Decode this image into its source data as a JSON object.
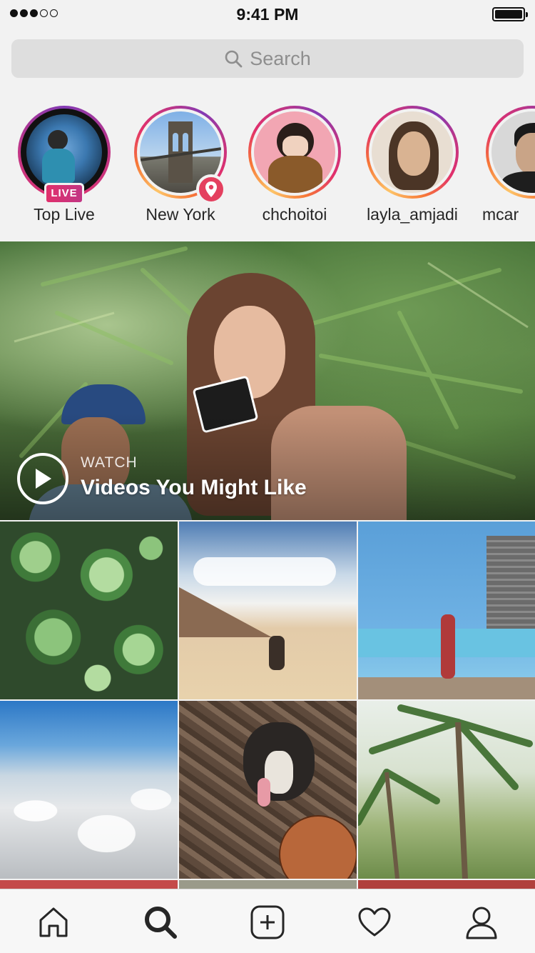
{
  "status_bar": {
    "time": "9:41 PM",
    "signal_bars_filled": 3,
    "signal_bars_total": 5,
    "battery_level": 1.0
  },
  "search": {
    "placeholder": "Search",
    "icon": "search-icon"
  },
  "stories": [
    {
      "label": "Top Live",
      "badge": "LIVE",
      "badge_color": "#e1306c"
    },
    {
      "label": "New York",
      "badge_icon": "location-pin-icon",
      "badge_color": "#e4405f"
    },
    {
      "label": "chchoitoi"
    },
    {
      "label": "layla_amjadi"
    },
    {
      "label": "mcar"
    }
  ],
  "featured": {
    "eyebrow": "WATCH",
    "title": "Videos You Might Like",
    "icon": "play-icon"
  },
  "grid": {
    "tiles": [
      {
        "subject": "succulents"
      },
      {
        "subject": "beach-dog"
      },
      {
        "subject": "blue-wall-woman"
      },
      {
        "subject": "clouds-from-above"
      },
      {
        "subject": "dog-basketball"
      },
      {
        "subject": "palm-trees"
      }
    ]
  },
  "tab_bar": {
    "tabs": [
      {
        "icon": "home-icon"
      },
      {
        "icon": "search-icon",
        "active": true
      },
      {
        "icon": "add-post-icon"
      },
      {
        "icon": "heart-icon"
      },
      {
        "icon": "profile-icon"
      }
    ]
  },
  "colors": {
    "story_ring": [
      "#fdc468",
      "#f77737",
      "#e1306c",
      "#c13584",
      "#833ab4"
    ],
    "text": "#262626",
    "muted": "#8e8e8e"
  }
}
